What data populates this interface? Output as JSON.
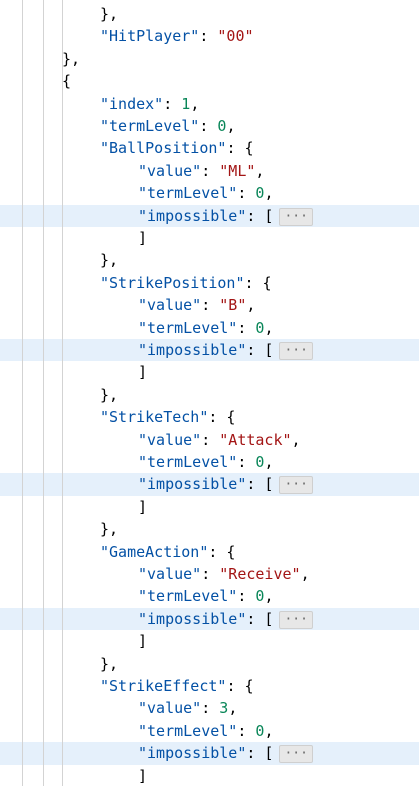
{
  "editor": {
    "lines": [
      {
        "indent": 3,
        "tokens": [
          {
            "t": "punc",
            "v": "},"
          }
        ]
      },
      {
        "indent": 3,
        "tokens": [
          {
            "t": "key",
            "v": "\"HitPlayer\""
          },
          {
            "t": "punc",
            "v": ": "
          },
          {
            "t": "str",
            "v": "\"00\""
          }
        ]
      },
      {
        "indent": 2,
        "tokens": [
          {
            "t": "punc",
            "v": "},"
          }
        ]
      },
      {
        "indent": 2,
        "tokens": [
          {
            "t": "punc",
            "v": "{"
          }
        ]
      },
      {
        "indent": 3,
        "tokens": [
          {
            "t": "key",
            "v": "\"index\""
          },
          {
            "t": "punc",
            "v": ": "
          },
          {
            "t": "num",
            "v": "1"
          },
          {
            "t": "punc",
            "v": ","
          }
        ]
      },
      {
        "indent": 3,
        "tokens": [
          {
            "t": "key",
            "v": "\"termLevel\""
          },
          {
            "t": "punc",
            "v": ": "
          },
          {
            "t": "num",
            "v": "0"
          },
          {
            "t": "punc",
            "v": ","
          }
        ]
      },
      {
        "indent": 3,
        "tokens": [
          {
            "t": "key",
            "v": "\"BallPosition\""
          },
          {
            "t": "punc",
            "v": ": {"
          }
        ]
      },
      {
        "indent": 4,
        "tokens": [
          {
            "t": "key",
            "v": "\"value\""
          },
          {
            "t": "punc",
            "v": ": "
          },
          {
            "t": "str",
            "v": "\"ML\""
          },
          {
            "t": "punc",
            "v": ","
          }
        ]
      },
      {
        "indent": 4,
        "tokens": [
          {
            "t": "key",
            "v": "\"termLevel\""
          },
          {
            "t": "punc",
            "v": ": "
          },
          {
            "t": "num",
            "v": "0"
          },
          {
            "t": "punc",
            "v": ","
          }
        ]
      },
      {
        "indent": 4,
        "highlight": true,
        "tokens": [
          {
            "t": "key",
            "v": "\"impossible\""
          },
          {
            "t": "punc",
            "v": ": ["
          },
          {
            "t": "fold",
            "v": "···"
          }
        ]
      },
      {
        "indent": 4,
        "tokens": [
          {
            "t": "punc",
            "v": "]"
          }
        ]
      },
      {
        "indent": 3,
        "tokens": [
          {
            "t": "punc",
            "v": "},"
          }
        ]
      },
      {
        "indent": 3,
        "tokens": [
          {
            "t": "key",
            "v": "\"StrikePosition\""
          },
          {
            "t": "punc",
            "v": ": {"
          }
        ]
      },
      {
        "indent": 4,
        "tokens": [
          {
            "t": "key",
            "v": "\"value\""
          },
          {
            "t": "punc",
            "v": ": "
          },
          {
            "t": "str",
            "v": "\"B\""
          },
          {
            "t": "punc",
            "v": ","
          }
        ]
      },
      {
        "indent": 4,
        "tokens": [
          {
            "t": "key",
            "v": "\"termLevel\""
          },
          {
            "t": "punc",
            "v": ": "
          },
          {
            "t": "num",
            "v": "0"
          },
          {
            "t": "punc",
            "v": ","
          }
        ]
      },
      {
        "indent": 4,
        "highlight": true,
        "tokens": [
          {
            "t": "key",
            "v": "\"impossible\""
          },
          {
            "t": "punc",
            "v": ": ["
          },
          {
            "t": "fold",
            "v": "···"
          }
        ]
      },
      {
        "indent": 4,
        "tokens": [
          {
            "t": "punc",
            "v": "]"
          }
        ]
      },
      {
        "indent": 3,
        "tokens": [
          {
            "t": "punc",
            "v": "},"
          }
        ]
      },
      {
        "indent": 3,
        "tokens": [
          {
            "t": "key",
            "v": "\"StrikeTech\""
          },
          {
            "t": "punc",
            "v": ": {"
          }
        ]
      },
      {
        "indent": 4,
        "tokens": [
          {
            "t": "key",
            "v": "\"value\""
          },
          {
            "t": "punc",
            "v": ": "
          },
          {
            "t": "str",
            "v": "\"Attack\""
          },
          {
            "t": "punc",
            "v": ","
          }
        ]
      },
      {
        "indent": 4,
        "tokens": [
          {
            "t": "key",
            "v": "\"termLevel\""
          },
          {
            "t": "punc",
            "v": ": "
          },
          {
            "t": "num",
            "v": "0"
          },
          {
            "t": "punc",
            "v": ","
          }
        ]
      },
      {
        "indent": 4,
        "highlight": true,
        "tokens": [
          {
            "t": "key",
            "v": "\"impossible\""
          },
          {
            "t": "punc",
            "v": ": ["
          },
          {
            "t": "fold",
            "v": "···"
          }
        ]
      },
      {
        "indent": 4,
        "tokens": [
          {
            "t": "punc",
            "v": "]"
          }
        ]
      },
      {
        "indent": 3,
        "tokens": [
          {
            "t": "punc",
            "v": "},"
          }
        ]
      },
      {
        "indent": 3,
        "tokens": [
          {
            "t": "key",
            "v": "\"GameAction\""
          },
          {
            "t": "punc",
            "v": ": {"
          }
        ]
      },
      {
        "indent": 4,
        "tokens": [
          {
            "t": "key",
            "v": "\"value\""
          },
          {
            "t": "punc",
            "v": ": "
          },
          {
            "t": "str",
            "v": "\"Receive\""
          },
          {
            "t": "punc",
            "v": ","
          }
        ]
      },
      {
        "indent": 4,
        "tokens": [
          {
            "t": "key",
            "v": "\"termLevel\""
          },
          {
            "t": "punc",
            "v": ": "
          },
          {
            "t": "num",
            "v": "0"
          },
          {
            "t": "punc",
            "v": ","
          }
        ]
      },
      {
        "indent": 4,
        "highlight": true,
        "tokens": [
          {
            "t": "key",
            "v": "\"impossible\""
          },
          {
            "t": "punc",
            "v": ": ["
          },
          {
            "t": "fold",
            "v": "···"
          }
        ]
      },
      {
        "indent": 4,
        "tokens": [
          {
            "t": "punc",
            "v": "]"
          }
        ]
      },
      {
        "indent": 3,
        "tokens": [
          {
            "t": "punc",
            "v": "},"
          }
        ]
      },
      {
        "indent": 3,
        "tokens": [
          {
            "t": "key",
            "v": "\"StrikeEffect\""
          },
          {
            "t": "punc",
            "v": ": {"
          }
        ]
      },
      {
        "indent": 4,
        "tokens": [
          {
            "t": "key",
            "v": "\"value\""
          },
          {
            "t": "punc",
            "v": ": "
          },
          {
            "t": "num",
            "v": "3"
          },
          {
            "t": "punc",
            "v": ","
          }
        ]
      },
      {
        "indent": 4,
        "tokens": [
          {
            "t": "key",
            "v": "\"termLevel\""
          },
          {
            "t": "punc",
            "v": ": "
          },
          {
            "t": "num",
            "v": "0"
          },
          {
            "t": "punc",
            "v": ","
          }
        ]
      },
      {
        "indent": 4,
        "highlight": true,
        "tokens": [
          {
            "t": "key",
            "v": "\"impossible\""
          },
          {
            "t": "punc",
            "v": ": ["
          },
          {
            "t": "fold",
            "v": "···"
          }
        ]
      },
      {
        "indent": 4,
        "tokens": [
          {
            "t": "punc",
            "v": "]"
          }
        ]
      }
    ],
    "colors": {
      "key": "#0451a5",
      "string": "#a31515",
      "number": "#098658",
      "punctuation": "#000000",
      "highlight": "#e5f0fb",
      "indent_guide": "#d3d3d3"
    }
  }
}
